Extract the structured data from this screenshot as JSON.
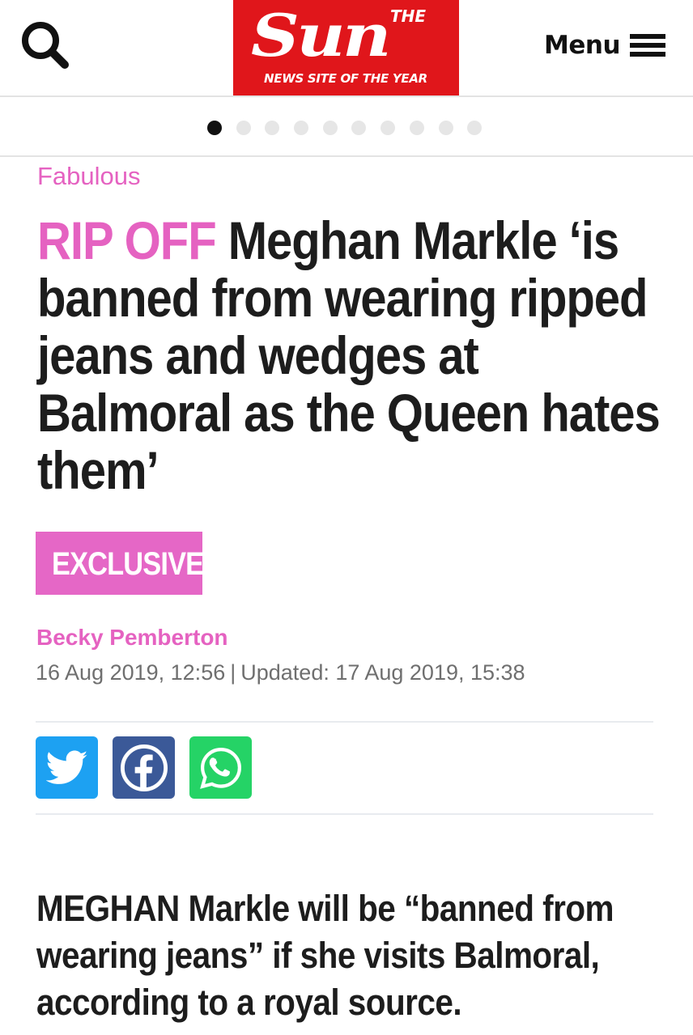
{
  "header": {
    "search_icon": "search-icon",
    "logo": {
      "the": "THE",
      "name": "Sun",
      "tagline": "NEWS SITE OF THE YEAR",
      "background": "#e0161b"
    },
    "menu_label": "Menu",
    "menu_icon": "hamburger-icon"
  },
  "carousel": {
    "total": 10,
    "active_index": 0
  },
  "article": {
    "section": "Fabulous",
    "kicker": "RIP OFF",
    "headline": "Meghan Markle ‘is banned from wearing ripped jeans and wedges at Balmoral as the Queen hates them’",
    "badge": "EXCLUSIVE",
    "author": "Becky Pemberton",
    "published": "16 Aug 2019, 12:56",
    "separator": "|",
    "updated": "Updated: 17 Aug 2019, 15:38",
    "standfirst": "MEGHAN Markle will be “banned from wearing jeans” if she visits Balmoral, according to a royal source."
  },
  "share": [
    {
      "network": "Twitter",
      "icon": "twitter-icon",
      "color": "#1da1f2"
    },
    {
      "network": "Facebook",
      "icon": "facebook-icon",
      "color": "#3b5998"
    },
    {
      "network": "WhatsApp",
      "icon": "whatsapp-icon",
      "color": "#25d366"
    }
  ],
  "colors": {
    "accent_pink": "#e562c1",
    "text": "#1d1d1d",
    "meta_gray": "#6f6f6f"
  }
}
